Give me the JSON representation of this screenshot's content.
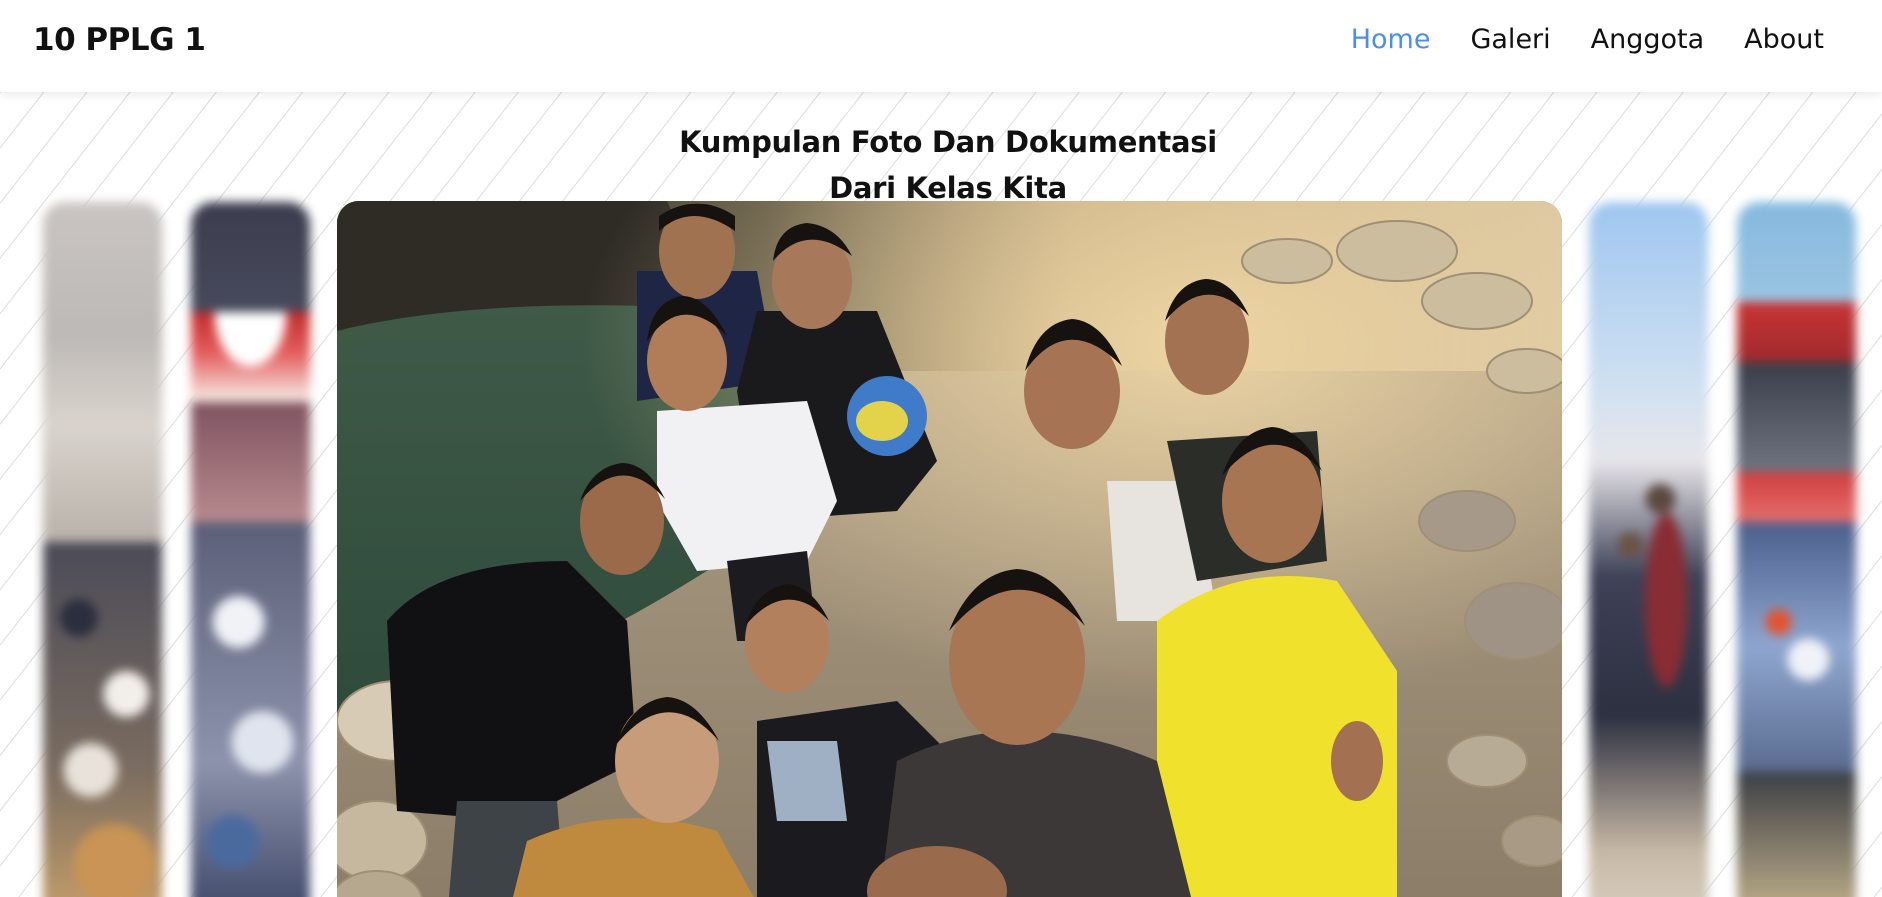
{
  "navbar": {
    "brand": "10 PPLG 1",
    "links": [
      {
        "label": "Home",
        "active": true
      },
      {
        "label": "Galeri",
        "active": false
      },
      {
        "label": "Anggota",
        "active": false
      },
      {
        "label": "About",
        "active": false
      }
    ]
  },
  "hero": {
    "title_line1": "Kumpulan Foto Dan Dokumentasi",
    "title_line2": "Dari Kelas Kita"
  },
  "colors": {
    "accent": "#4c8ef0",
    "text": "#111111",
    "background": "#ffffff",
    "pattern_line": "#d6d6d6"
  },
  "gallery": {
    "left_strips": [
      "left-strip-photo-1",
      "left-strip-photo-2"
    ],
    "main_photo": "group-selfie-photo",
    "right_strips": [
      "right-strip-photo-1",
      "right-strip-photo-2"
    ]
  }
}
